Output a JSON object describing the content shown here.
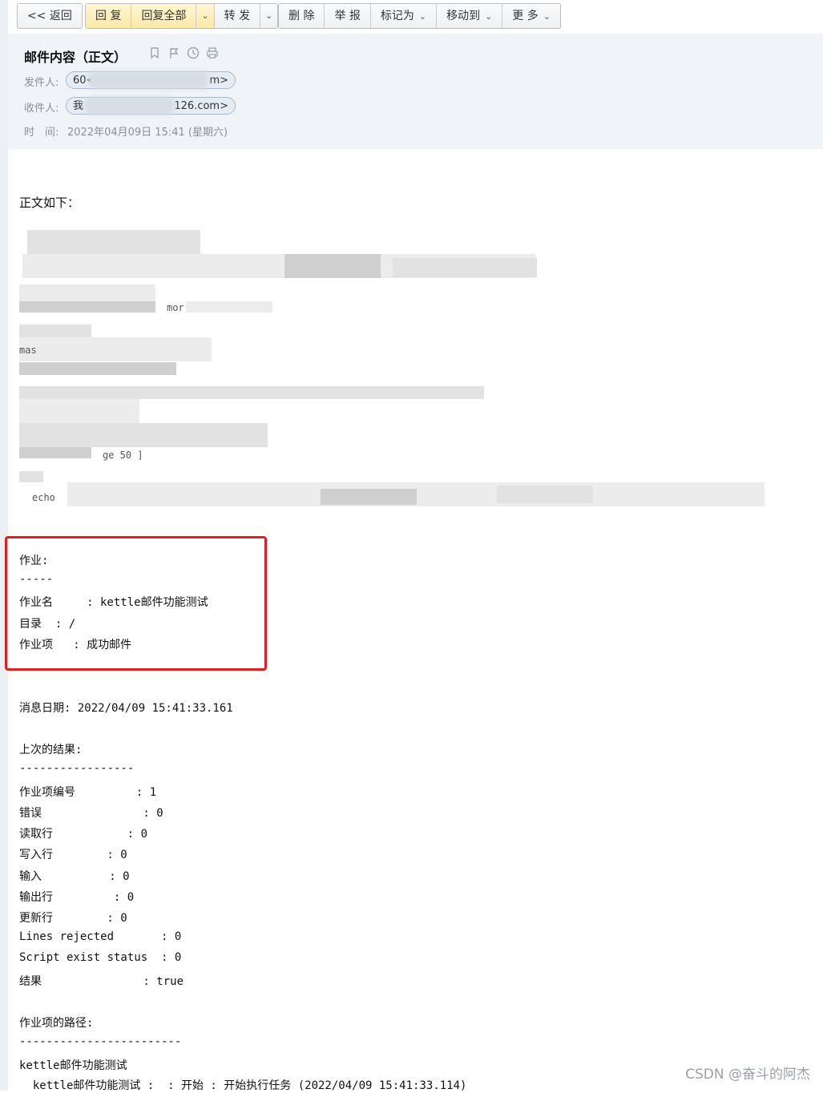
{
  "toolbar": {
    "back": "<< 返回",
    "reply": "回 复",
    "reply_all": "回复全部",
    "forward": "转 发",
    "delete": "删 除",
    "report": "举 报",
    "mark_as": "标记为",
    "move_to": "移动到",
    "more": "更 多"
  },
  "header": {
    "subject": "邮件内容（正文）",
    "from_label": "发件人:",
    "from_start": "60<",
    "from_end": "m>",
    "to_label": "收件人:",
    "to_start": "我",
    "to_end": "126.com>",
    "time_label": "时　间:",
    "time_value": "2022年04月09日 15:41 (星期六)"
  },
  "body": {
    "intro": "正文如下：",
    "fragments": [
      "mor",
      "ge 50 ]",
      "echo",
      "mas"
    ],
    "job_section": {
      "lines": [
        "作业:",
        "-----",
        "作业名     : kettle邮件功能测试",
        "目录  : /",
        "作业项   : 成功邮件"
      ]
    },
    "message_date": "消息日期: 2022/04/09 15:41:33.161",
    "last_result": {
      "lines": [
        "上次的结果:",
        "-----------------",
        "作业项编号         : 1",
        "错误               : 0",
        "读取行           : 0",
        "写入行        : 0",
        "输入          : 0",
        "输出行         : 0",
        "更新行        : 0",
        "Lines rejected       : 0",
        "Script exist status  : 0",
        "结果               : true"
      ]
    },
    "job_path": {
      "lines": [
        "作业项的路径:",
        "------------------------",
        "kettle邮件功能测试",
        "  kettle邮件功能测试 :  : 开始 : 开始执行任务 (2022/04/09 15:41:33.114)"
      ]
    }
  },
  "watermark": "CSDN @奋斗的阿杰"
}
